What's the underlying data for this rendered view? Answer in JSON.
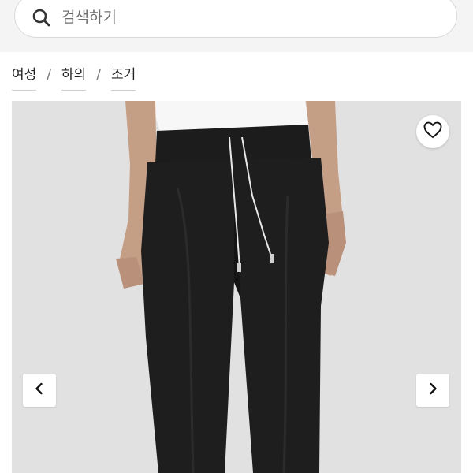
{
  "search": {
    "placeholder": "검색하기",
    "icon": "search-icon"
  },
  "breadcrumb": {
    "items": [
      "여성",
      "하의",
      "조거"
    ],
    "separator": "/"
  },
  "gallery": {
    "image_description_icon": "product-photo",
    "favorite_icon": "heart-icon",
    "prev_icon": "chevron-left-icon",
    "next_icon": "chevron-right-icon"
  },
  "colors": {
    "background": "#ffffff",
    "top_band": "#f4f4f4",
    "image_bg": "#e4e4e4",
    "text": "#222222"
  }
}
